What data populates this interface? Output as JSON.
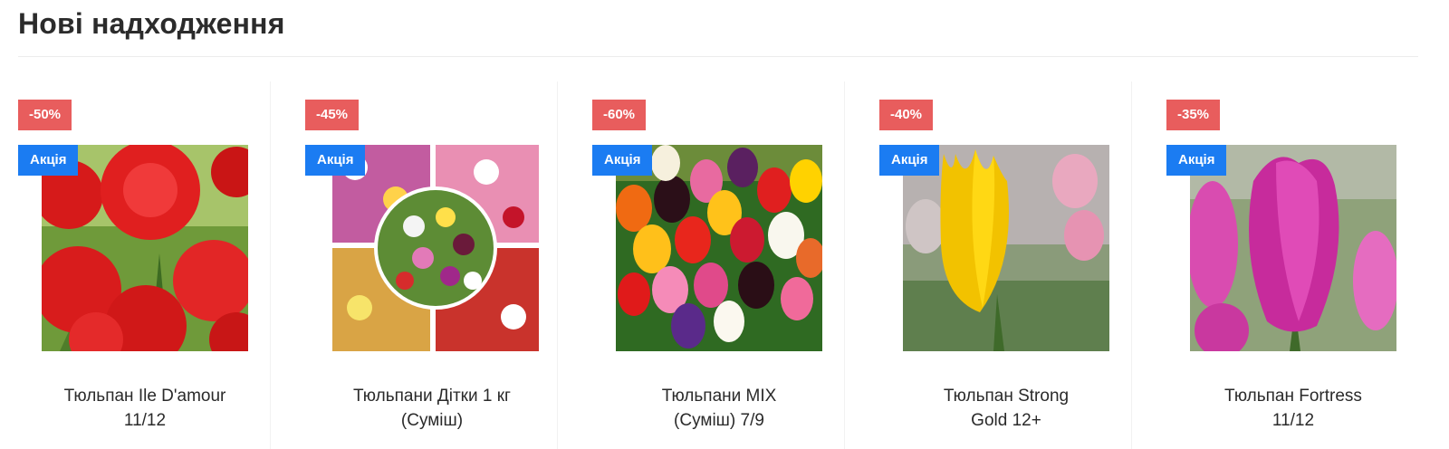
{
  "section": {
    "title": "Нові надходження"
  },
  "products": [
    {
      "discount": "-50%",
      "promo": "Акція",
      "name_line1": "Тюльпан Ile D'amour",
      "name_line2": "11/12",
      "image": "red-double-tulips"
    },
    {
      "discount": "-45%",
      "promo": "Акція",
      "name_line1": "Тюльпани Дітки 1 кг",
      "name_line2": "(Суміш)",
      "image": "mixed-tulips-collage"
    },
    {
      "discount": "-60%",
      "promo": "Акція",
      "name_line1": "Тюльпани MIX",
      "name_line2": "(Суміш) 7/9",
      "image": "mixed-color-tulips"
    },
    {
      "discount": "-40%",
      "promo": "Акція",
      "name_line1": "Тюльпан Strong",
      "name_line2": "Gold 12+",
      "image": "yellow-tulip"
    },
    {
      "discount": "-35%",
      "promo": "Акція",
      "name_line1": "Тюльпан Fortress",
      "name_line2": "11/12",
      "image": "pink-tulip"
    }
  ],
  "colors": {
    "discount_badge": "#e85d5d",
    "promo_badge": "#1b7cf2",
    "title": "#2b2b2b"
  }
}
